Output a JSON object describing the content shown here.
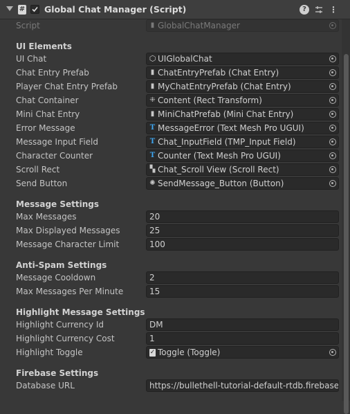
{
  "component": {
    "title": "Global Chat Manager (Script)",
    "icons": {
      "foldout": "foldout-arrow-icon",
      "script": "script-file-icon",
      "help": "help-icon",
      "presets": "presets-icon",
      "menu": "kebab-menu-icon"
    }
  },
  "script_row": {
    "label": "Script",
    "value": "GlobalChatManager"
  },
  "ui_elements": {
    "header": "UI Elements",
    "rows": [
      {
        "label": "UI Chat",
        "value": "UIGlobalChat",
        "icon": "gameobject-cube-icon"
      },
      {
        "label": "Chat Entry Prefab",
        "value": "ChatEntryPrefab (Chat Entry)",
        "icon": "script-file-icon"
      },
      {
        "label": "Player Chat Entry Prefab",
        "value": "MyChatEntryPrefab (Chat Entry)",
        "icon": "script-file-icon"
      },
      {
        "label": "Chat Container",
        "value": "Content (Rect Transform)",
        "icon": "rect-transform-icon"
      },
      {
        "label": "Mini Chat Entry",
        "value": "MiniChatPrefab (Mini Chat Entry)",
        "icon": "script-file-icon"
      },
      {
        "label": "Error Message",
        "value": "MessageError (Text Mesh Pro UGUI)",
        "icon": "textmeshpro-icon"
      },
      {
        "label": "Message Input Field",
        "value": "Chat_InputField (TMP_Input Field)",
        "icon": "textmeshpro-icon"
      },
      {
        "label": "Character Counter",
        "value": "Counter (Text Mesh Pro UGUI)",
        "icon": "textmeshpro-icon"
      },
      {
        "label": "Scroll Rect",
        "value": "Chat_Scroll View (Scroll Rect)",
        "icon": "scroll-rect-icon"
      },
      {
        "label": "Send Button",
        "value": "SendMessage_Button (Button)",
        "icon": "button-icon"
      }
    ]
  },
  "message_settings": {
    "header": "Message Settings",
    "rows": [
      {
        "label": "Max Messages",
        "value": "20"
      },
      {
        "label": "Max Displayed Messages",
        "value": "25"
      },
      {
        "label": "Message Character Limit",
        "value": "100"
      }
    ]
  },
  "anti_spam": {
    "header": "Anti-Spam Settings",
    "rows": [
      {
        "label": "Message Cooldown",
        "value": "2"
      },
      {
        "label": "Max Messages Per Minute",
        "value": "15"
      }
    ]
  },
  "highlight": {
    "header": "Highlight Message Settings",
    "rows": [
      {
        "label": "Highlight Currency Id",
        "value": "DM"
      },
      {
        "label": "Highlight Currency Cost",
        "value": "1"
      }
    ],
    "toggle_row": {
      "label": "Highlight Toggle",
      "value": "Toggle (Toggle)",
      "icon": "toggle-icon"
    }
  },
  "firebase": {
    "header": "Firebase Settings",
    "rows": [
      {
        "label": "Database URL",
        "value": "https://bullethell-tutorial-default-rtdb.firebaseio.com/"
      }
    ]
  },
  "colors": {
    "background": "#383838",
    "field": "#2a2a2a",
    "tmp_icon": "#3ea6f0"
  }
}
